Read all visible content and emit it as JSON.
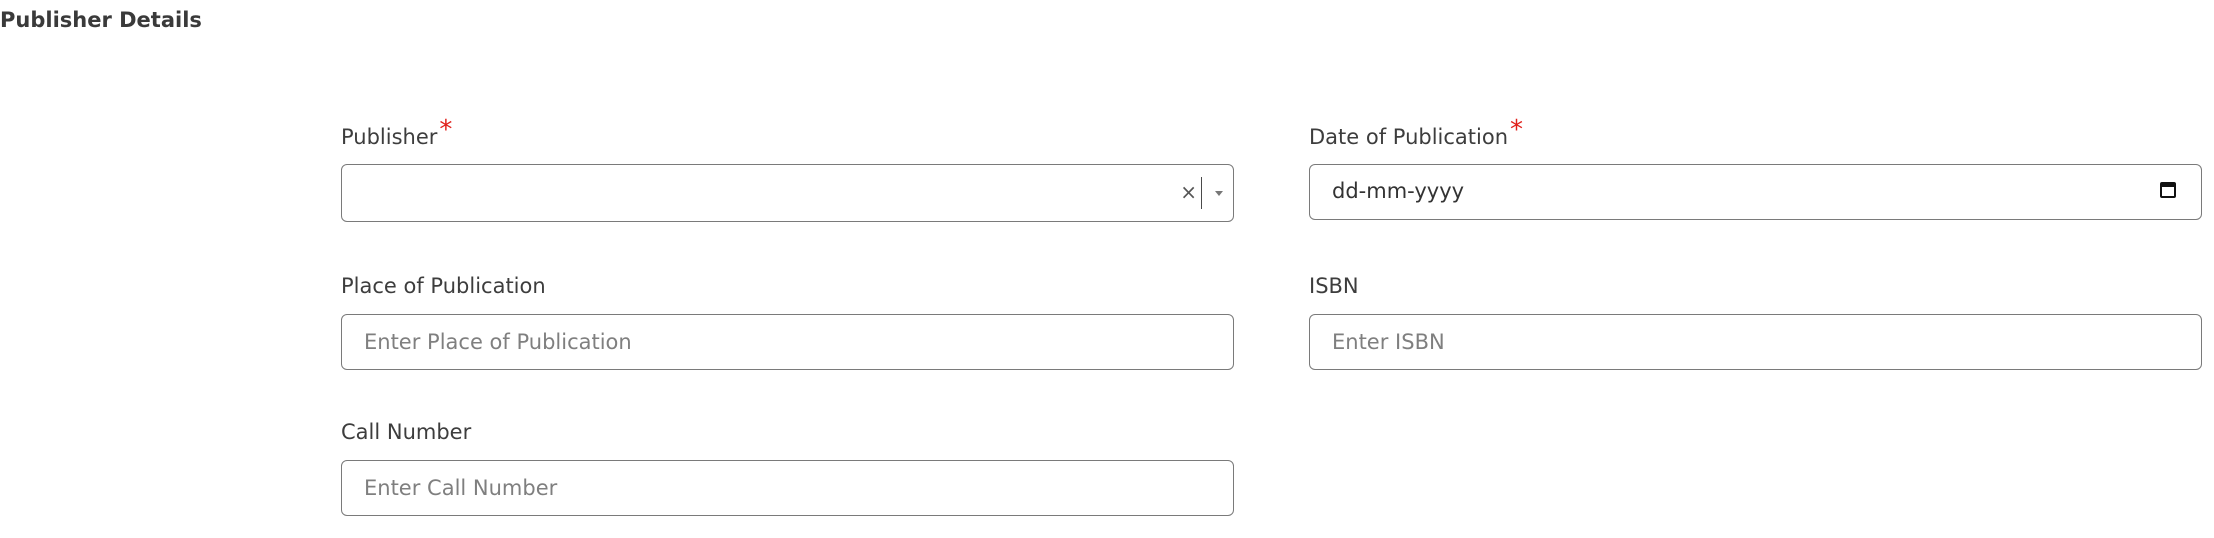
{
  "section": {
    "title": "Publisher Details"
  },
  "required_marker": "*",
  "fields": {
    "publisher": {
      "label": "Publisher",
      "value": "",
      "clear_glyph": "×"
    },
    "date_of_publication": {
      "label": "Date of Publication",
      "value": "dd-mm-yyyy"
    },
    "place_of_publication": {
      "label": "Place of Publication",
      "placeholder": "Enter Place of Publication",
      "value": ""
    },
    "isbn": {
      "label": "ISBN",
      "placeholder": "Enter ISBN",
      "value": ""
    },
    "call_number": {
      "label": "Call Number",
      "placeholder": "Enter Call Number",
      "value": ""
    }
  },
  "icons": {
    "clear": "close-icon",
    "dropdown": "chevron-down-icon",
    "calendar": "calendar-icon"
  },
  "colors": {
    "required": "#e0201b",
    "border": "#7a7a7a",
    "label_text": "#3d3d3d",
    "placeholder_text": "#7f7f7f"
  }
}
